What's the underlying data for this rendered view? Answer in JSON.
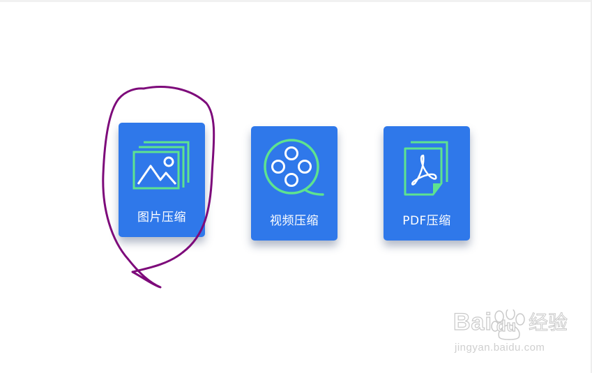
{
  "colors": {
    "card_bg": "#2f78ea",
    "icon_accent": "#5ee38f",
    "icon_stroke": "#ffffff",
    "annotation": "#7d0a7a",
    "watermark": "#c9c9c9"
  },
  "tools": [
    {
      "id": "image",
      "label": "图片压缩",
      "icon": "image-gallery-icon"
    },
    {
      "id": "video",
      "label": "视频压缩",
      "icon": "film-reel-icon"
    },
    {
      "id": "pdf",
      "label": "PDF压缩",
      "icon": "pdf-document-icon"
    }
  ],
  "watermark": {
    "brand_left": "Bai",
    "brand_right": "du",
    "brand_cn": "经验",
    "url": "jingyan.baidu.com"
  }
}
